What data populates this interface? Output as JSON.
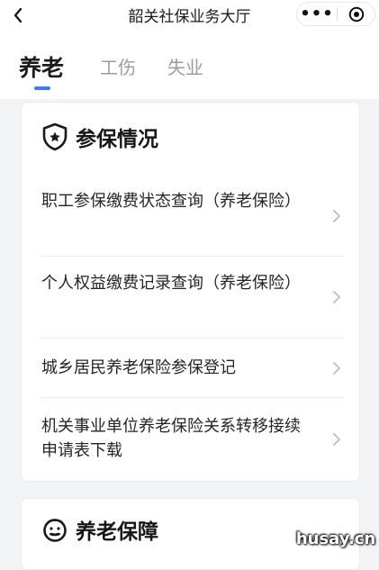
{
  "nav": {
    "title": "韶关社保业务大厅",
    "more": "•••"
  },
  "tabs": [
    {
      "label": "养老",
      "active": true
    },
    {
      "label": "工伤",
      "active": false
    },
    {
      "label": "失业",
      "active": false
    }
  ],
  "sections": [
    {
      "title": "参保情况",
      "icon": "shield-star-icon",
      "items": [
        {
          "label": "职工参保缴费状态查询（养老保险）"
        },
        {
          "label": "个人权益缴费记录查询（养老保险）"
        },
        {
          "label": "城乡居民养老保险参保登记"
        },
        {
          "label": "机关事业单位养老保险关系转移接续申请表下载"
        }
      ]
    },
    {
      "title": "养老保障",
      "icon": "elder-face-icon"
    }
  ],
  "watermark": "husay.cn",
  "colors": {
    "accent": "#3b7cff",
    "background": "#f2f3f5",
    "inactive_tab": "#9b9b9b",
    "chevron": "#bdbdbd"
  }
}
